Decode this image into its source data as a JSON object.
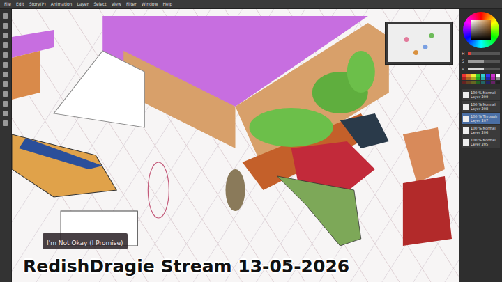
{
  "menu": [
    {
      "label": "File"
    },
    {
      "label": "Edit"
    },
    {
      "label": "Story(P)"
    },
    {
      "label": "Animation"
    },
    {
      "label": "Layer"
    },
    {
      "label": "Select"
    },
    {
      "label": "View"
    },
    {
      "label": "Filter"
    },
    {
      "label": "Window"
    },
    {
      "label": "Help"
    }
  ],
  "color_sliders": [
    {
      "name": "H",
      "level": 0.1,
      "color": "#e0413a"
    },
    {
      "name": "S",
      "level": 0.5,
      "color": "#9a9a9a"
    },
    {
      "name": "V",
      "level": 0.5,
      "color": "#d8d8d8"
    }
  ],
  "layers": [
    {
      "name": "Layer 209",
      "mode": "100 % Normal",
      "selected": false
    },
    {
      "name": "Layer 208",
      "mode": "100 % Normal",
      "selected": false
    },
    {
      "name": "Layer 207",
      "mode": "100 % Through",
      "selected": true
    },
    {
      "name": "Layer 206",
      "mode": "100 % Normal",
      "selected": false
    },
    {
      "name": "Layer 205",
      "mode": "100 % Normal",
      "selected": false
    }
  ],
  "song": {
    "title": "I'm Not Okay (I Promise)"
  },
  "stream_title": "RedishDragie Stream 13-05-2026"
}
